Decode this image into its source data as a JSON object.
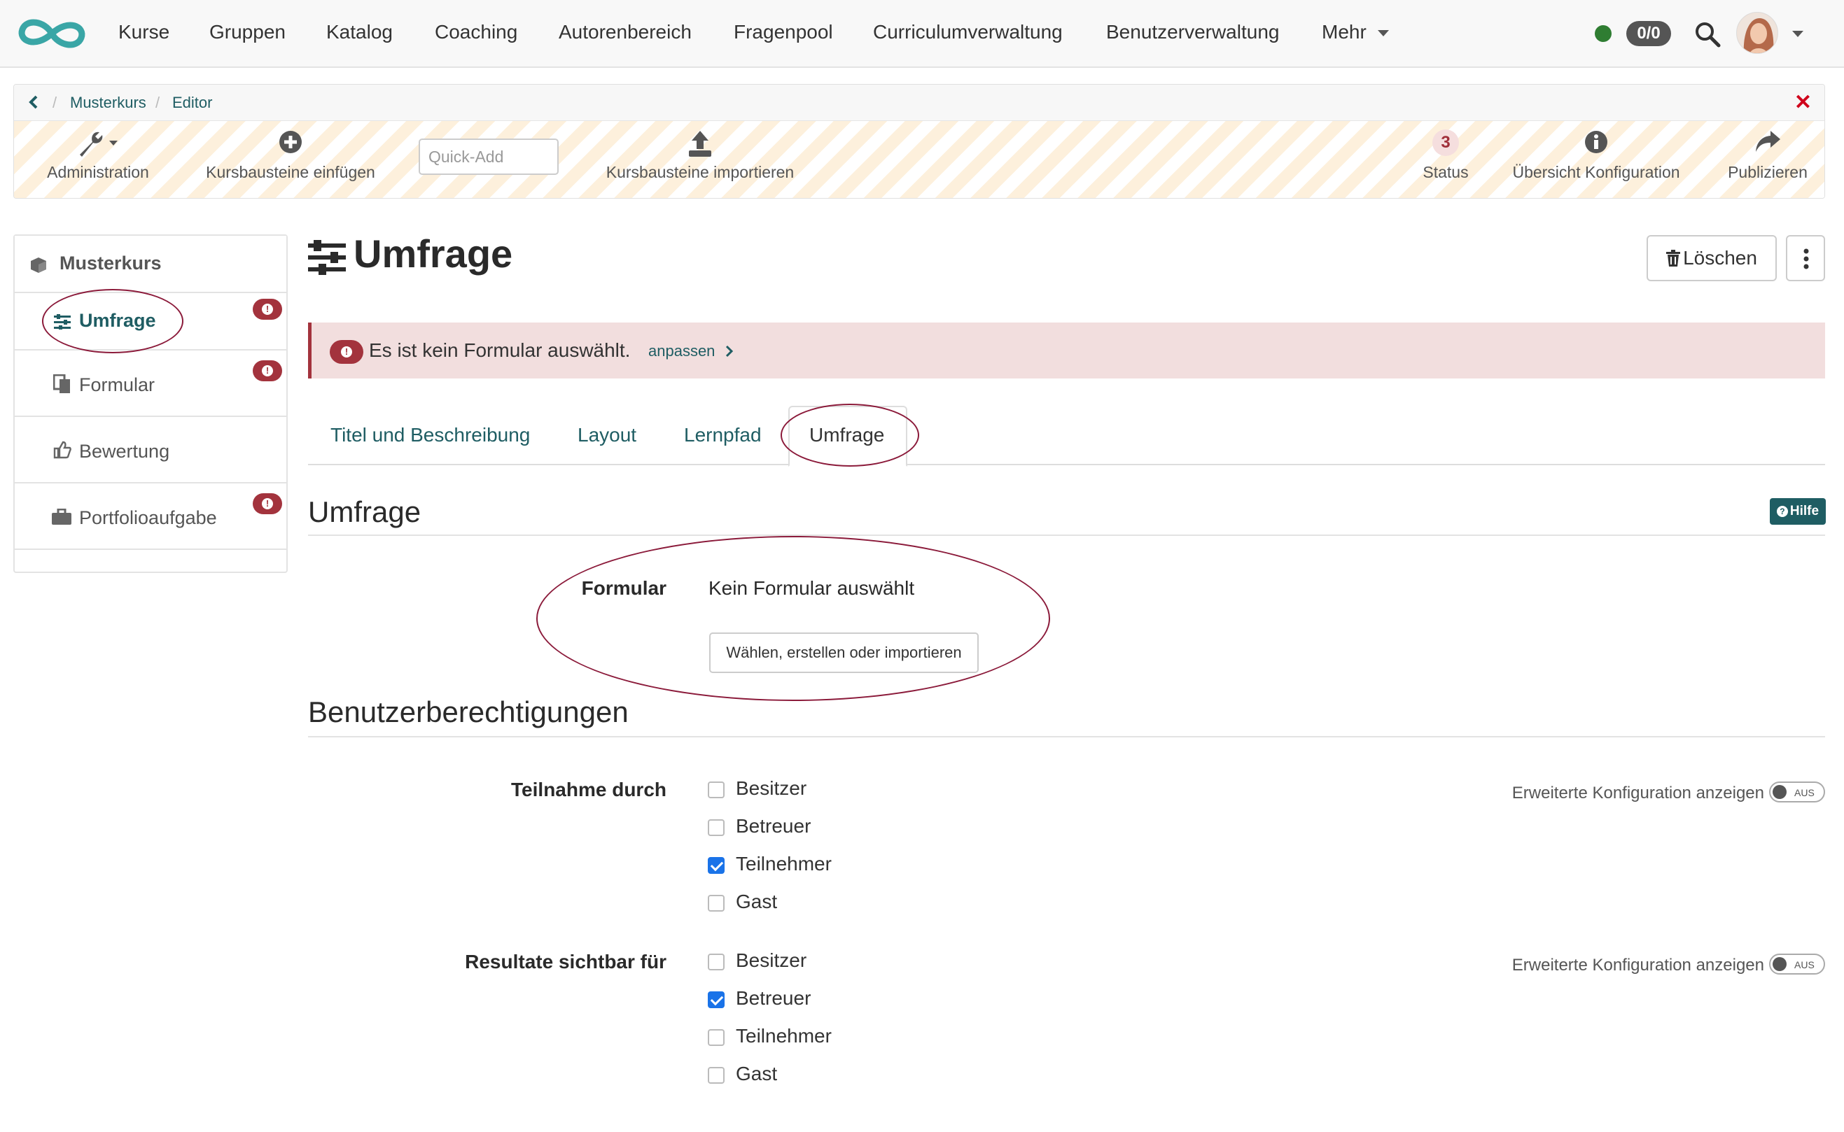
{
  "nav": {
    "items": [
      "Kurse",
      "Gruppen",
      "Katalog",
      "Coaching",
      "Autorenbereich",
      "Fragenpool",
      "Curriculumverwaltung",
      "Benutzerverwaltung",
      "Mehr"
    ],
    "badge": "0/0"
  },
  "breadcrumb": {
    "course": "Musterkurs",
    "page": "Editor"
  },
  "toolbar": {
    "administration": "Administration",
    "insert": "Kursbausteine einfügen",
    "quickadd_placeholder": "Quick-Add",
    "import": "Kursbausteine importieren",
    "status_count": "3",
    "status": "Status",
    "overview": "Übersicht Konfiguration",
    "publish": "Publizieren"
  },
  "tree": {
    "root": "Musterkurs",
    "items": [
      {
        "label": "Umfrage",
        "icon": "sliders-icon",
        "warning": true
      },
      {
        "label": "Formular",
        "icon": "form-icon",
        "warning": true
      },
      {
        "label": "Bewertung",
        "icon": "thumbs-up-icon",
        "warning": false
      },
      {
        "label": "Portfolioaufgabe",
        "icon": "briefcase-icon",
        "warning": true
      }
    ]
  },
  "page": {
    "title": "Umfrage",
    "delete": "Löschen",
    "alert_text": "Es ist kein Formular auswählt.",
    "alert_link": "anpassen"
  },
  "tabs": [
    "Titel und Beschreibung",
    "Layout",
    "Lernpfad",
    "Umfrage"
  ],
  "survey": {
    "title": "Umfrage",
    "help": "Hilfe",
    "form_label": "Formular",
    "form_value": "Kein Formular auswählt",
    "choose_button": "Wählen, erstellen oder importieren"
  },
  "permissions": {
    "title": "Benutzerberechtigungen",
    "advanced_label": "Erweiterte Konfiguration anzeigen",
    "toggle_text": "AUS",
    "participation": {
      "label": "Teilnahme durch",
      "options": [
        {
          "label": "Besitzer",
          "checked": false
        },
        {
          "label": "Betreuer",
          "checked": false
        },
        {
          "label": "Teilnehmer",
          "checked": true
        },
        {
          "label": "Gast",
          "checked": false
        }
      ]
    },
    "results": {
      "label": "Resultate sichtbar für",
      "options": [
        {
          "label": "Besitzer",
          "checked": false
        },
        {
          "label": "Betreuer",
          "checked": true
        },
        {
          "label": "Teilnehmer",
          "checked": false
        },
        {
          "label": "Gast",
          "checked": false
        }
      ]
    }
  },
  "colors": {
    "accent": "#1f5d63",
    "danger": "#a3333d",
    "stripe": "#fdf0dc",
    "check": "#1a73e8"
  }
}
